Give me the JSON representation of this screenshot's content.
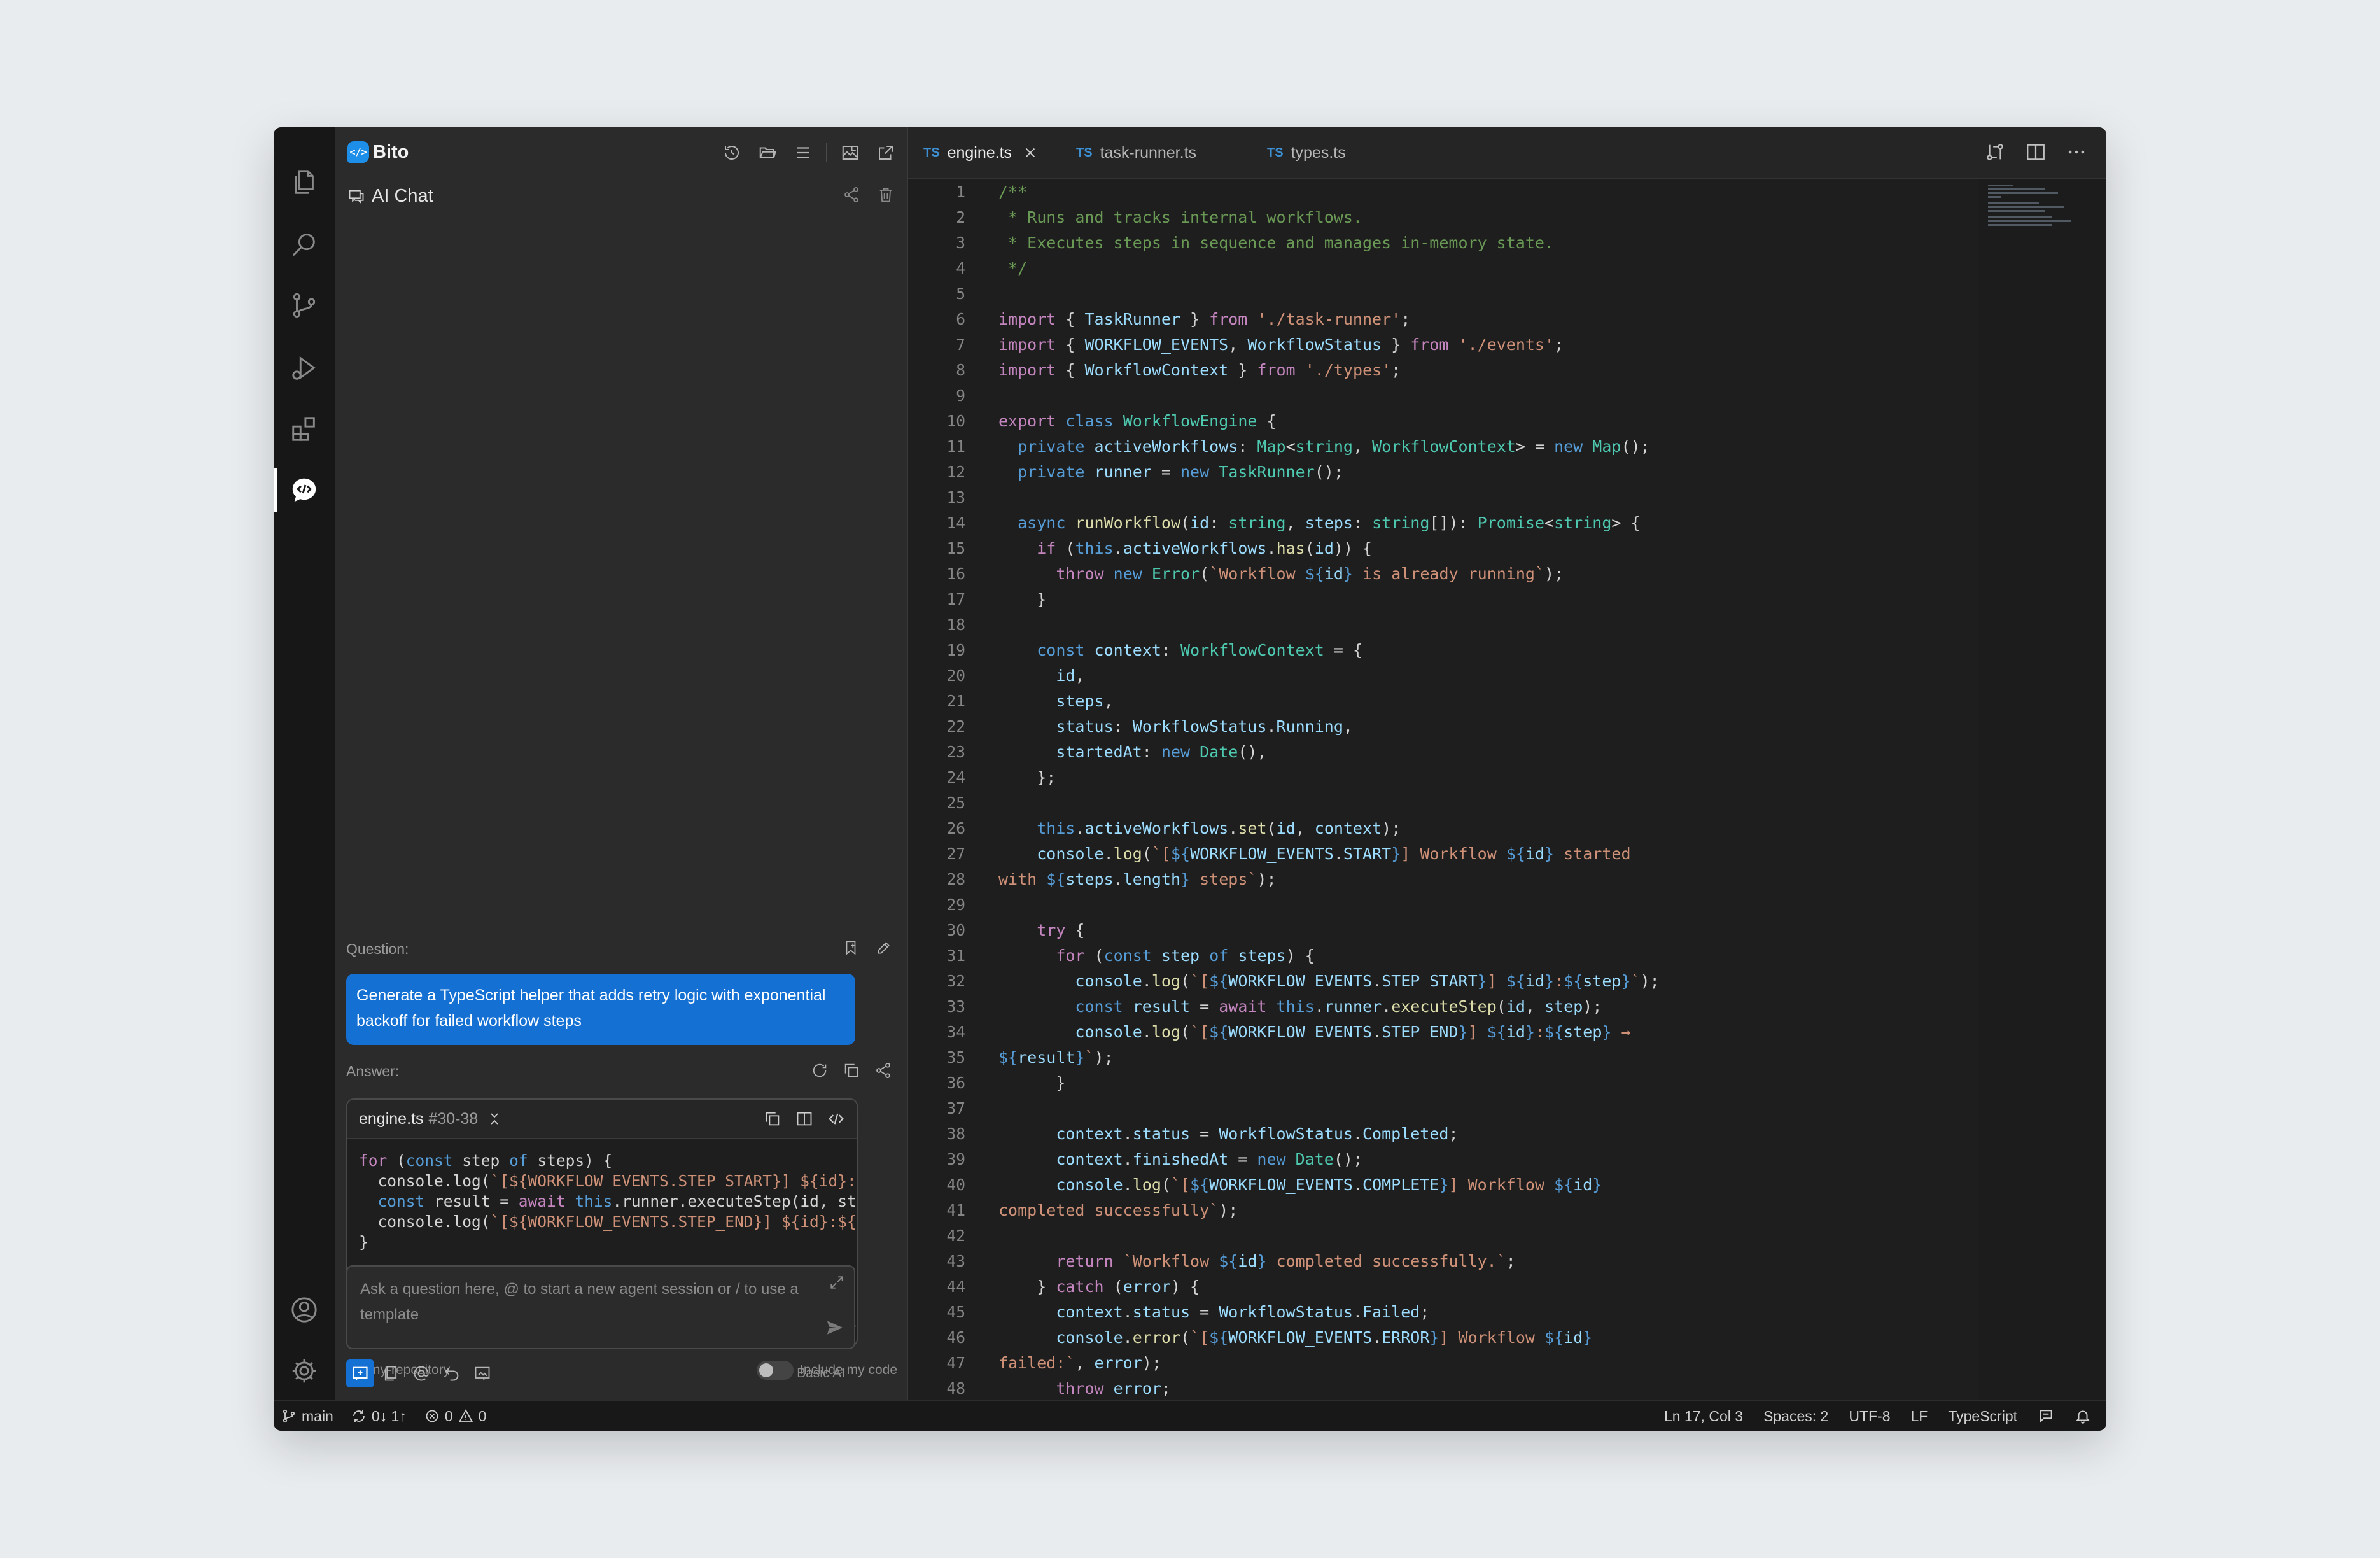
{
  "colors": {
    "accent": "#1570d3",
    "brand": "#1e8fe9",
    "editor_bg": "#1e1e1e",
    "panel_bg": "#2b2b2b"
  },
  "activity_bar": {
    "icons": [
      "explorer-icon",
      "search-icon",
      "source-control-icon",
      "run-debug-icon",
      "extensions-icon",
      "bito-chat-icon",
      "account-icon",
      "settings-gear-icon"
    ],
    "active": "bito-chat-icon"
  },
  "chat": {
    "brand_name": "Bito",
    "logo_glyph": "</>",
    "title": "AI Chat",
    "question_label": "Question:",
    "question_text": "Generate a TypeScript helper that adds retry logic with exponential backoff for failed workflow steps",
    "answer_label": "Answer:",
    "code_block": {
      "filename": "engine.ts",
      "range": "#30-38",
      "lines": [
        "for (const step of steps) {",
        "  console.log(`[${WORKFLOW_EVENTS.STEP_START}] ${id}:${step}`);",
        "  const result = await this.runner.executeStep(id, step);",
        "  console.log(`[${WORKFLOW_EVENTS.STEP_END}] ${id}:${step} → ${result}`);",
        "}",
        "",
        "context.status = WorkflowStatus.Completed;",
        "context.finishedAt = new Date();",
        "console.log(`[${WORKFLOW_EVENTS.COMPLETE}] Workflow ${id} completed successfully`);"
      ]
    },
    "repository": "my-repository",
    "include_code_label": "Include my code",
    "include_code_enabled": false,
    "input_placeholder": "Ask a question here, @ to start a new agent session or / to use a template",
    "mode_label": "Basic AI"
  },
  "editor": {
    "tabs": [
      {
        "lang": "TS",
        "name": "engine.ts",
        "active": true
      },
      {
        "lang": "TS",
        "name": "task-runner.ts",
        "active": false
      },
      {
        "lang": "TS",
        "name": "types.ts",
        "active": false
      }
    ],
    "first_line": 1,
    "last_line": 48
  },
  "status_bar": {
    "branch": "main",
    "sync": "0↓ 1↑",
    "errors": "0",
    "warnings": "0",
    "cursor": "Ln 17, Col 3",
    "indent": "Spaces: 2",
    "encoding": "UTF-8",
    "eol": "LF",
    "language": "TypeScript"
  }
}
